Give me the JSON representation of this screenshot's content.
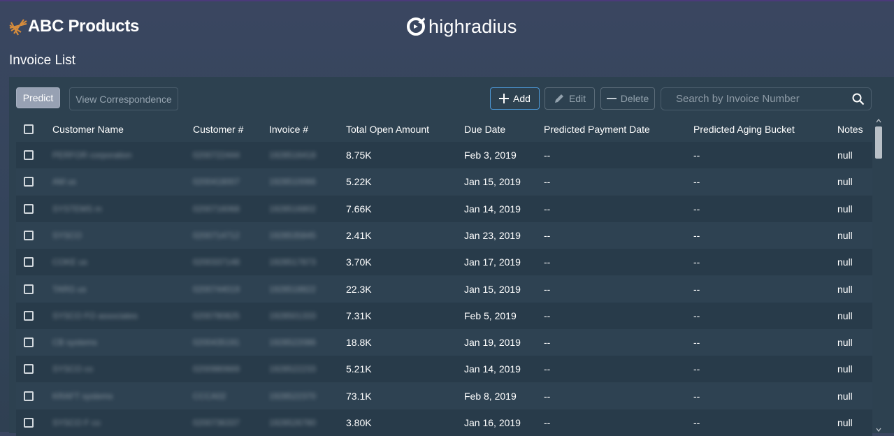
{
  "brand": {
    "name": "ABC Products"
  },
  "partner": {
    "name": "highradius"
  },
  "page": {
    "title": "Invoice List"
  },
  "toolbar": {
    "predict_label": "Predict",
    "view_correspondence_label": "View Correspondence",
    "add_label": "Add",
    "edit_label": "Edit",
    "delete_label": "Delete",
    "search_placeholder": "Search by Invoice Number"
  },
  "table": {
    "columns": [
      "Customer Name",
      "Customer #",
      "Invoice #",
      "Total Open Amount",
      "Due Date",
      "Predicted Payment Date",
      "Predicted Aging Bucket",
      "Notes"
    ],
    "rows": [
      {
        "customer_name": "PERFOR corporation",
        "customer_no": "0200722444",
        "invoice_no": "1928516418",
        "amount": "8.75K",
        "due_date": "Feb 3, 2019",
        "pred_date": "--",
        "aging": "--",
        "notes": "null"
      },
      {
        "customer_name": "AM us",
        "customer_no": "0200418007",
        "invoice_no": "1928510066",
        "amount": "5.22K",
        "due_date": "Jan 15, 2019",
        "pred_date": "--",
        "aging": "--",
        "notes": "null"
      },
      {
        "customer_name": "SYSTEMS m",
        "customer_no": "0200716068",
        "invoice_no": "1928516802",
        "amount": "7.66K",
        "due_date": "Jan 14, 2019",
        "pred_date": "--",
        "aging": "--",
        "notes": "null"
      },
      {
        "customer_name": "SYSCO",
        "customer_no": "0200714712",
        "invoice_no": "1928535845",
        "amount": "2.41K",
        "due_date": "Jan 23, 2019",
        "pred_date": "--",
        "aging": "--",
        "notes": "null"
      },
      {
        "customer_name": "COKE us",
        "customer_no": "0200337148",
        "invoice_no": "1928517873",
        "amount": "3.70K",
        "due_date": "Jan 17, 2019",
        "pred_date": "--",
        "aging": "--",
        "notes": "null"
      },
      {
        "customer_name": "TARG us",
        "customer_no": "0200744019",
        "invoice_no": "1928518822",
        "amount": "22.3K",
        "due_date": "Jan 15, 2019",
        "pred_date": "--",
        "aging": "--",
        "notes": "null"
      },
      {
        "customer_name": "SYSCO FO associates",
        "customer_no": "0200780825",
        "invoice_no": "1928501333",
        "amount": "7.31K",
        "due_date": "Feb 5, 2019",
        "pred_date": "--",
        "aging": "--",
        "notes": "null"
      },
      {
        "customer_name": "CB systems",
        "customer_no": "0200435191",
        "invoice_no": "1928522086",
        "amount": "18.8K",
        "due_date": "Jan 19, 2019",
        "pred_date": "--",
        "aging": "--",
        "notes": "null"
      },
      {
        "customer_name": "SYSCO co",
        "customer_no": "0200980669",
        "invoice_no": "1928522233",
        "amount": "5.21K",
        "due_date": "Jan 14, 2019",
        "pred_date": "--",
        "aging": "--",
        "notes": "null"
      },
      {
        "customer_name": "KRAFT systems",
        "customer_no": "CCCA02",
        "invoice_no": "1928522370",
        "amount": "73.1K",
        "due_date": "Feb 8, 2019",
        "pred_date": "--",
        "aging": "--",
        "notes": "null"
      },
      {
        "customer_name": "SYSCO F co",
        "customer_no": "0200736337",
        "invoice_no": "1928526780",
        "amount": "3.80K",
        "due_date": "Jan 16, 2019",
        "pred_date": "--",
        "aging": "--",
        "notes": "null"
      }
    ]
  }
}
